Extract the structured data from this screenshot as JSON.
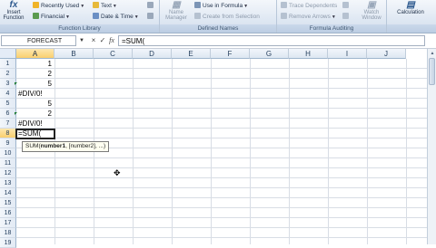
{
  "ribbon": {
    "function_library": {
      "insert_function_label": "Insert Function",
      "recently_used_label": "Recently Used",
      "financial_label": "Financial",
      "text_label": "Text",
      "date_time_label": "Date & Time",
      "group_label": "Function Library"
    },
    "defined_names": {
      "name_manager_label": "Name Manager",
      "use_in_formula_label": "Use in Formula",
      "create_from_selection_label": "Create from Selection",
      "group_label": "Defined Names"
    },
    "formula_auditing": {
      "trace_dependents_label": "Trace Dependents",
      "remove_arrows_label": "Remove Arrows",
      "watch_window_label": "Watch Window",
      "group_label": "Formula Auditing"
    },
    "calculation": {
      "calculation_label": "Calculation"
    }
  },
  "formula_bar": {
    "name_box": "FORECAST",
    "formula": "=SUM(",
    "cancel_symbol": "×",
    "enter_symbol": "✓",
    "fx_symbol": "fx"
  },
  "columns": [
    "A",
    "B",
    "C",
    "D",
    "E",
    "F",
    "G",
    "H",
    "I",
    "J"
  ],
  "active_column": "A",
  "rows": [
    "1",
    "2",
    "3",
    "4",
    "5",
    "6",
    "7",
    "8",
    "9",
    "10",
    "11",
    "12",
    "13",
    "14",
    "15",
    "16",
    "17",
    "18",
    "19"
  ],
  "active_row": "8",
  "cells": {
    "A1": "1",
    "A2": "2",
    "A3": "5",
    "A4": "#DIV/0!",
    "A5": "5",
    "A6": "2",
    "A7": "#DIV/0!",
    "A8": "=SUM("
  },
  "tooltip": {
    "func": "SUM(",
    "arg1": "number1",
    "rest": ", [number2], ...)"
  },
  "colors": {
    "accent": "#2e5a8f",
    "active_header": "#f9cf6e",
    "error_triangle": "#1e7a2e"
  }
}
